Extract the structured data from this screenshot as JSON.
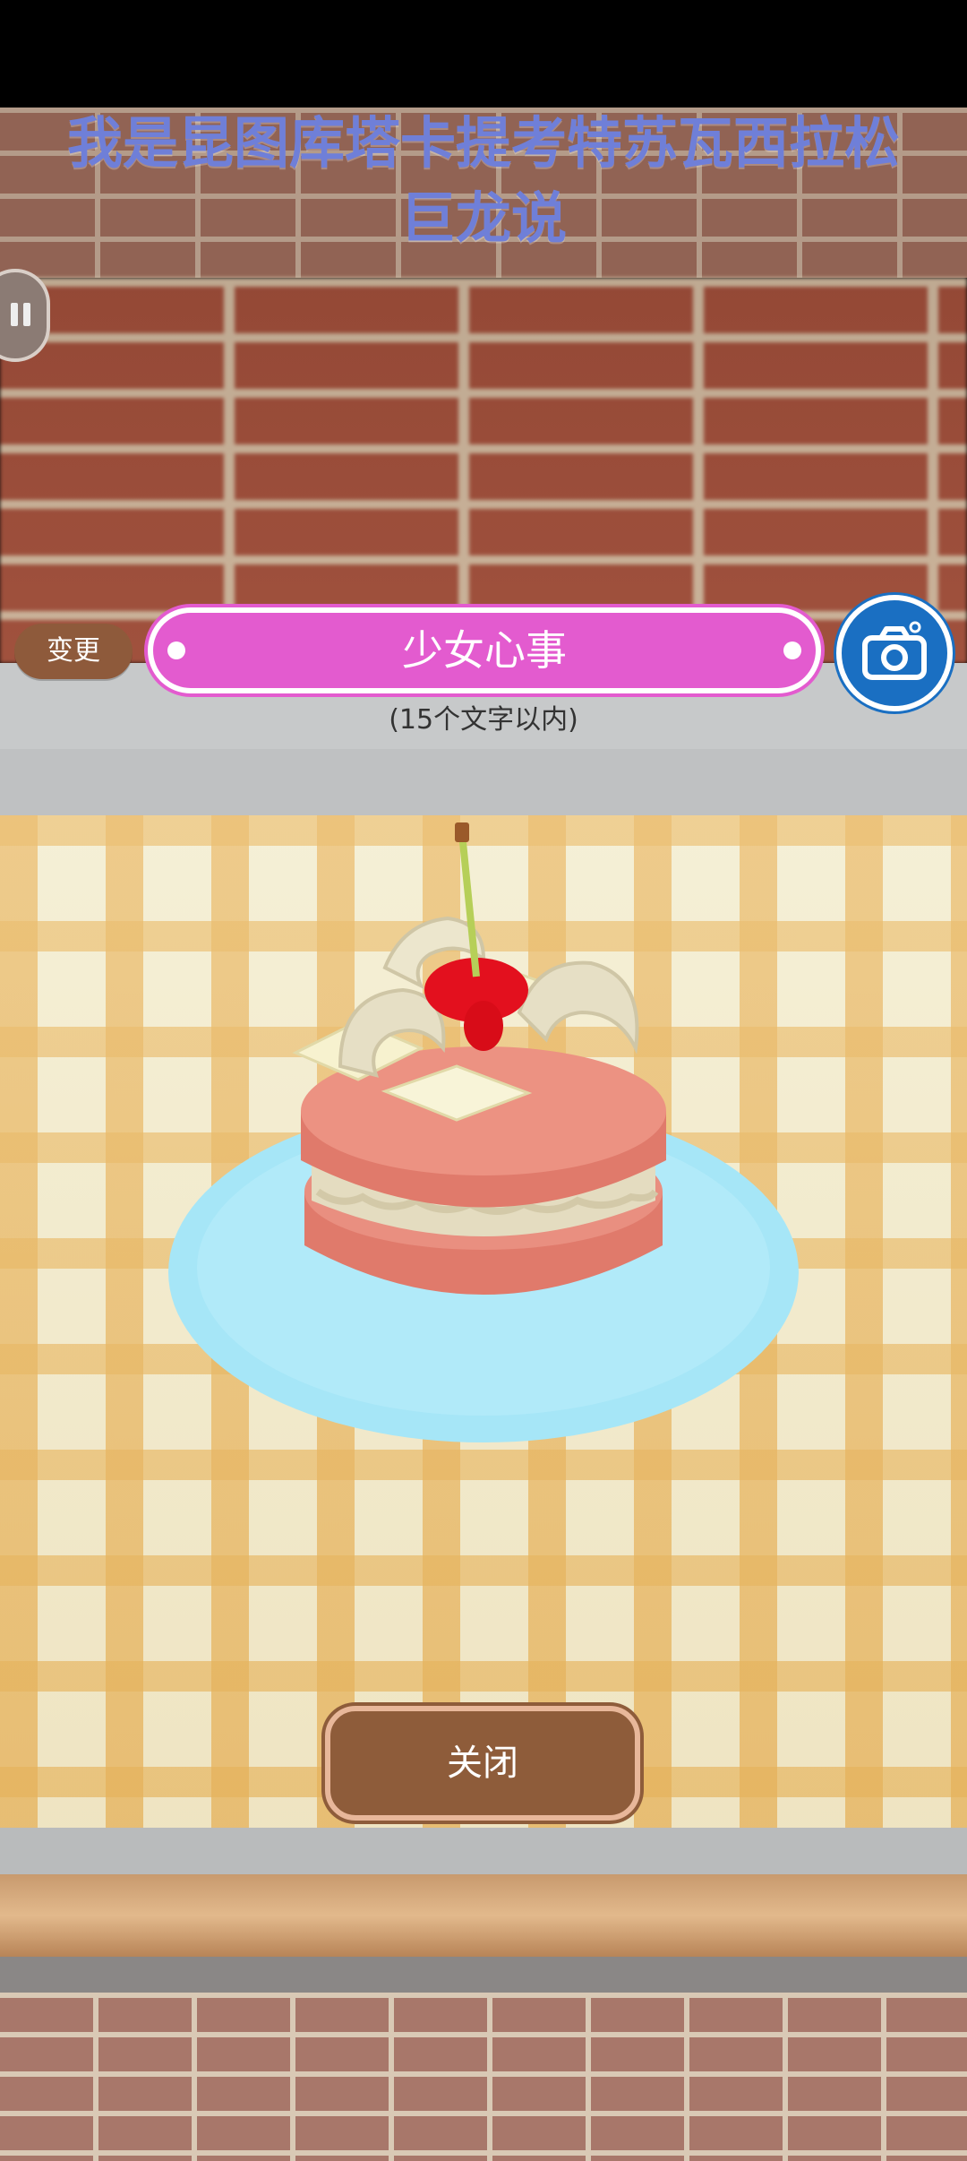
{
  "header": {
    "title": "我是昆图库塔卡提考特苏瓦西拉松\n巨龙说"
  },
  "controls": {
    "change_label": "变更",
    "name_value": "少女心事",
    "hint": "(15个文字以内)",
    "close_label": "关闭"
  },
  "icons": {
    "pause": "pause-icon",
    "camera": "camera-icon"
  },
  "colors": {
    "title": "#6f7fd8",
    "name_bar": "#e35bcf",
    "camera_button": "#1a6fc2",
    "brown_button": "#8e5c3a",
    "plate": "#a6e6f7",
    "cake": "#e88a7a",
    "cream": "#e9e3c7",
    "cherry": "#e3101e"
  }
}
